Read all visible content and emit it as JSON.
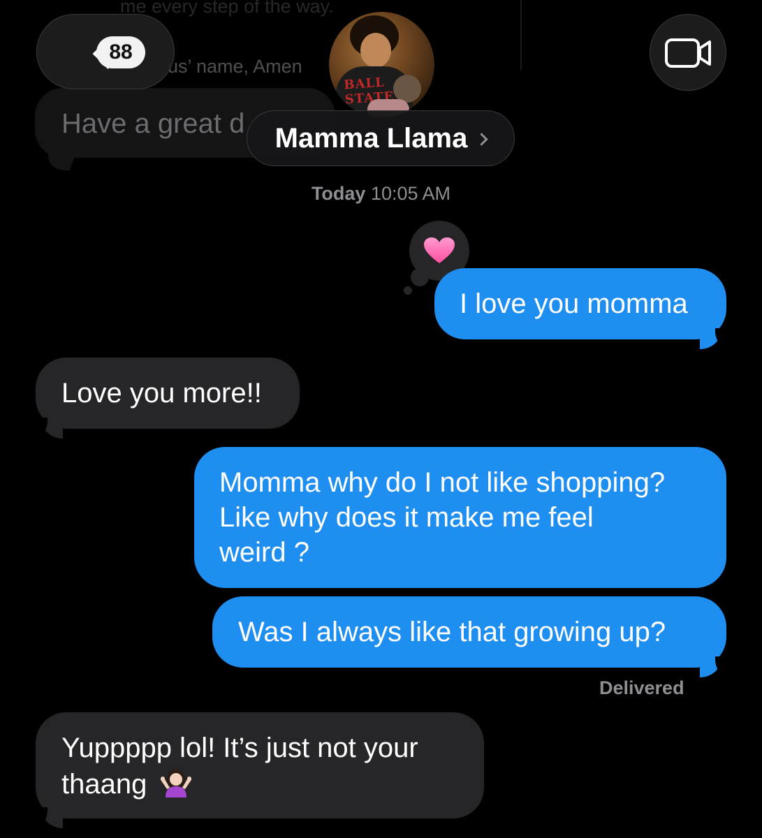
{
  "background": {
    "line_1": "me every step of the way.",
    "line_2": "us’ name, Amen",
    "bubble_text": "Have a great d"
  },
  "header": {
    "unread_count": "88",
    "contact_name": "Mamma Llama",
    "avatar_shirt_text": "BALL STATE"
  },
  "thread": {
    "timestamp_day": "Today",
    "timestamp_time": "10:05 AM",
    "messages": [
      {
        "from": "me",
        "text": "I love you momma",
        "reaction": "heart"
      },
      {
        "from": "them",
        "text": "Love you more!!"
      },
      {
        "from": "me",
        "lines": [
          "Momma why do I not like shopping?",
          "Like why does it make me feel",
          "weird ?"
        ]
      },
      {
        "from": "me",
        "text": "Was I always like that growing up?"
      },
      {
        "from": "them",
        "lines": [
          "Yuppppp lol! It’s just not your",
          "thaang"
        ],
        "emoji": "woman-shrugging"
      }
    ],
    "status": "Delivered"
  },
  "colors": {
    "sent_bubble": "#1f8ef1",
    "received_bubble": "#262628",
    "heart": "#ff6fb0"
  },
  "icons": {
    "back": "chevron-left-icon",
    "video": "video-camera-icon",
    "name_chevron": "chevron-right-icon",
    "reaction": "heart-icon",
    "emoji": "woman-shrugging-icon"
  }
}
